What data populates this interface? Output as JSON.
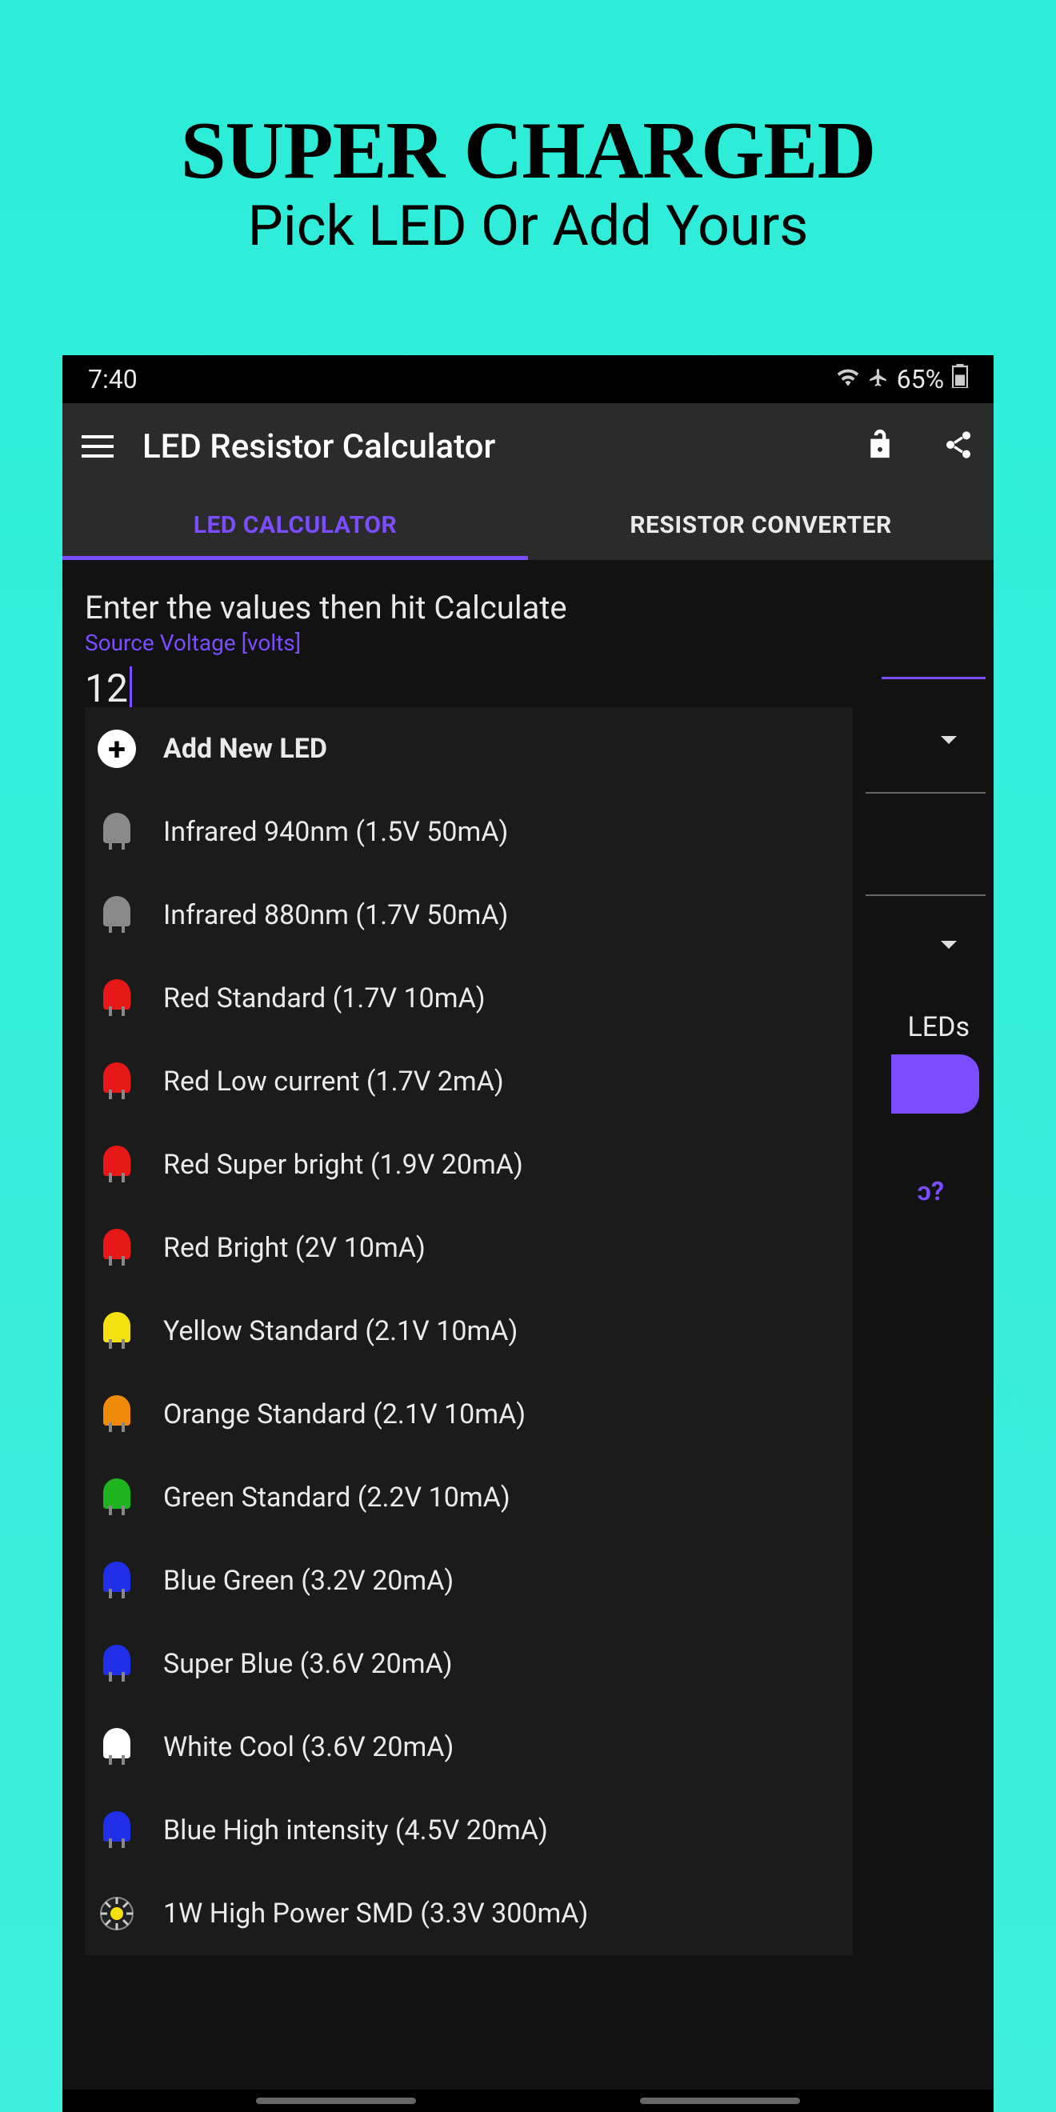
{
  "promo": {
    "title": "SUPER CHARGED",
    "subtitle": "Pick LED Or Add Yours"
  },
  "status": {
    "time": "7:40",
    "battery": "65%"
  },
  "appbar": {
    "title": "LED Resistor Calculator"
  },
  "tabs": {
    "active": "LED CALCULATOR",
    "inactive": "RESISTOR CONVERTER"
  },
  "form": {
    "instruction": "Enter the values then hit Calculate",
    "voltage_label": "Source Voltage [volts]",
    "voltage_value": "12"
  },
  "background": {
    "leds_text": "LEDs",
    "question": "ɔ?"
  },
  "dropdown": {
    "add_new": "Add New LED",
    "items": [
      {
        "label": "Infrared 940nm (1.5V 50mA)",
        "color": "#8a8a8a"
      },
      {
        "label": "Infrared 880nm (1.7V 50mA)",
        "color": "#8a8a8a"
      },
      {
        "label": "Red Standard (1.7V 10mA)",
        "color": "#E81818"
      },
      {
        "label": "Red Low current (1.7V 2mA)",
        "color": "#E81818"
      },
      {
        "label": "Red Super bright (1.9V 20mA)",
        "color": "#E81818"
      },
      {
        "label": "Red Bright (2V 10mA)",
        "color": "#E81818"
      },
      {
        "label": "Yellow Standard (2.1V 10mA)",
        "color": "#F5E10F"
      },
      {
        "label": "Orange Standard (2.1V 10mA)",
        "color": "#F08A0A"
      },
      {
        "label": "Green Standard (2.2V 10mA)",
        "color": "#1FB31F"
      },
      {
        "label": "Blue Green (3.2V 20mA)",
        "color": "#2030E8"
      },
      {
        "label": "Super Blue (3.6V 20mA)",
        "color": "#2030E8"
      },
      {
        "label": "White Cool (3.6V 20mA)",
        "color": "#FFFFFF"
      },
      {
        "label": "Blue High intensity (4.5V 20mA)",
        "color": "#2030E8"
      },
      {
        "label": "1W High Power SMD (3.3V 300mA)",
        "color": "smd"
      }
    ]
  }
}
